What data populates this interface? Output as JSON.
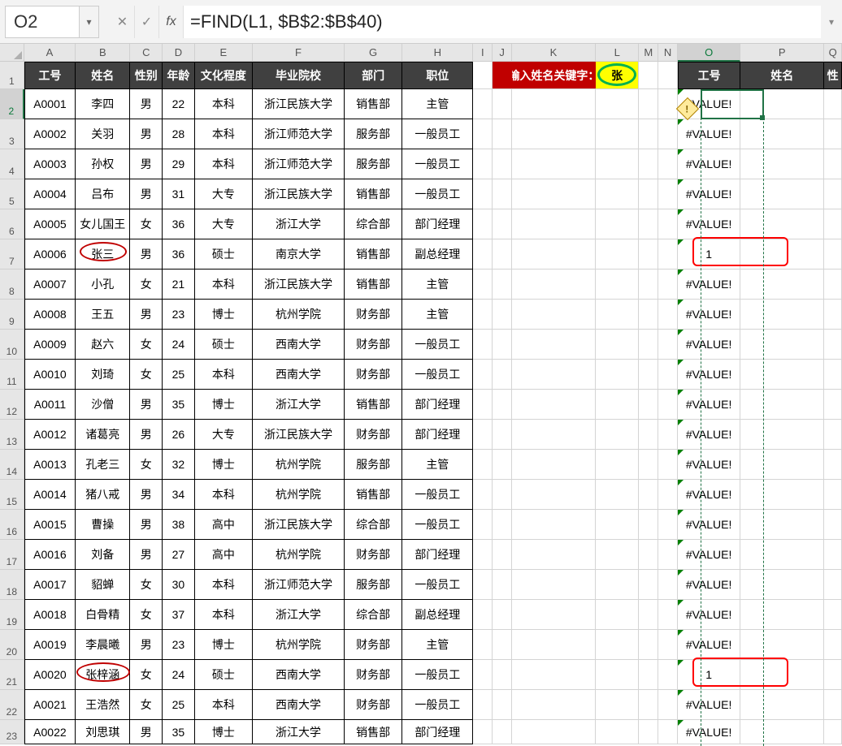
{
  "formula_bar": {
    "name_box": "O2",
    "cancel_icon": "✕",
    "accept_icon": "✓",
    "fx_label": "fx",
    "formula": "=FIND(L1, $B$2:$B$40)",
    "expand_icon": "▾"
  },
  "col_letters": [
    "A",
    "B",
    "C",
    "D",
    "E",
    "F",
    "G",
    "H",
    "I",
    "J",
    "K",
    "L",
    "M",
    "N",
    "O",
    "P",
    "Q"
  ],
  "headers": {
    "A": "工号",
    "B": "姓名",
    "C": "性别",
    "D": "年龄",
    "E": "文化程度",
    "F": "毕业院校",
    "G": "部门",
    "H": "职位",
    "K": "输入姓名关键字：",
    "L": "张",
    "O": "工号",
    "P": "姓名",
    "Q": "性"
  },
  "data": [
    {
      "id": "A0001",
      "name": "李四",
      "sex": "男",
      "age": "22",
      "edu": "本科",
      "school": "浙江民族大学",
      "dept": "销售部",
      "pos": "主管",
      "o": "#VALUE!"
    },
    {
      "id": "A0002",
      "name": "关羽",
      "sex": "男",
      "age": "28",
      "edu": "本科",
      "school": "浙江师范大学",
      "dept": "服务部",
      "pos": "一般员工",
      "o": "#VALUE!"
    },
    {
      "id": "A0003",
      "name": "孙权",
      "sex": "男",
      "age": "29",
      "edu": "本科",
      "school": "浙江师范大学",
      "dept": "服务部",
      "pos": "一般员工",
      "o": "#VALUE!"
    },
    {
      "id": "A0004",
      "name": "吕布",
      "sex": "男",
      "age": "31",
      "edu": "大专",
      "school": "浙江民族大学",
      "dept": "销售部",
      "pos": "一般员工",
      "o": "#VALUE!"
    },
    {
      "id": "A0005",
      "name": "女儿国王",
      "sex": "女",
      "age": "36",
      "edu": "大专",
      "school": "浙江大学",
      "dept": "综合部",
      "pos": "部门经理",
      "o": "#VALUE!"
    },
    {
      "id": "A0006",
      "name": "张三",
      "sex": "男",
      "age": "36",
      "edu": "硕士",
      "school": "南京大学",
      "dept": "销售部",
      "pos": "副总经理",
      "o": "1"
    },
    {
      "id": "A0007",
      "name": "小孔",
      "sex": "女",
      "age": "21",
      "edu": "本科",
      "school": "浙江民族大学",
      "dept": "销售部",
      "pos": "主管",
      "o": "#VALUE!"
    },
    {
      "id": "A0008",
      "name": "王五",
      "sex": "男",
      "age": "23",
      "edu": "博士",
      "school": "杭州学院",
      "dept": "财务部",
      "pos": "主管",
      "o": "#VALUE!"
    },
    {
      "id": "A0009",
      "name": "赵六",
      "sex": "女",
      "age": "24",
      "edu": "硕士",
      "school": "西南大学",
      "dept": "财务部",
      "pos": "一般员工",
      "o": "#VALUE!"
    },
    {
      "id": "A0010",
      "name": "刘琦",
      "sex": "女",
      "age": "25",
      "edu": "本科",
      "school": "西南大学",
      "dept": "财务部",
      "pos": "一般员工",
      "o": "#VALUE!"
    },
    {
      "id": "A0011",
      "name": "沙僧",
      "sex": "男",
      "age": "35",
      "edu": "博士",
      "school": "浙江大学",
      "dept": "销售部",
      "pos": "部门经理",
      "o": "#VALUE!"
    },
    {
      "id": "A0012",
      "name": "诸葛亮",
      "sex": "男",
      "age": "26",
      "edu": "大专",
      "school": "浙江民族大学",
      "dept": "财务部",
      "pos": "部门经理",
      "o": "#VALUE!"
    },
    {
      "id": "A0013",
      "name": "孔老三",
      "sex": "女",
      "age": "32",
      "edu": "博士",
      "school": "杭州学院",
      "dept": "服务部",
      "pos": "主管",
      "o": "#VALUE!"
    },
    {
      "id": "A0014",
      "name": "猪八戒",
      "sex": "男",
      "age": "34",
      "edu": "本科",
      "school": "杭州学院",
      "dept": "销售部",
      "pos": "一般员工",
      "o": "#VALUE!"
    },
    {
      "id": "A0015",
      "name": "曹操",
      "sex": "男",
      "age": "38",
      "edu": "高中",
      "school": "浙江民族大学",
      "dept": "综合部",
      "pos": "一般员工",
      "o": "#VALUE!"
    },
    {
      "id": "A0016",
      "name": "刘备",
      "sex": "男",
      "age": "27",
      "edu": "高中",
      "school": "杭州学院",
      "dept": "财务部",
      "pos": "部门经理",
      "o": "#VALUE!"
    },
    {
      "id": "A0017",
      "name": "貂蝉",
      "sex": "女",
      "age": "30",
      "edu": "本科",
      "school": "浙江师范大学",
      "dept": "服务部",
      "pos": "一般员工",
      "o": "#VALUE!"
    },
    {
      "id": "A0018",
      "name": "白骨精",
      "sex": "女",
      "age": "37",
      "edu": "本科",
      "school": "浙江大学",
      "dept": "综合部",
      "pos": "副总经理",
      "o": "#VALUE!"
    },
    {
      "id": "A0019",
      "name": "李晨曦",
      "sex": "男",
      "age": "23",
      "edu": "博士",
      "school": "杭州学院",
      "dept": "财务部",
      "pos": "主管",
      "o": "#VALUE!"
    },
    {
      "id": "A0020",
      "name": "张梓涵",
      "sex": "女",
      "age": "24",
      "edu": "硕士",
      "school": "西南大学",
      "dept": "财务部",
      "pos": "一般员工",
      "o": "1"
    },
    {
      "id": "A0021",
      "name": "王浩然",
      "sex": "女",
      "age": "25",
      "edu": "本科",
      "school": "西南大学",
      "dept": "财务部",
      "pos": "一般员工",
      "o": "#VALUE!"
    },
    {
      "id": "A0022",
      "name": "刘思琪",
      "sex": "男",
      "age": "35",
      "edu": "博士",
      "school": "浙江大学",
      "dept": "销售部",
      "pos": "部门经理",
      "o": "#VALUE!"
    }
  ]
}
